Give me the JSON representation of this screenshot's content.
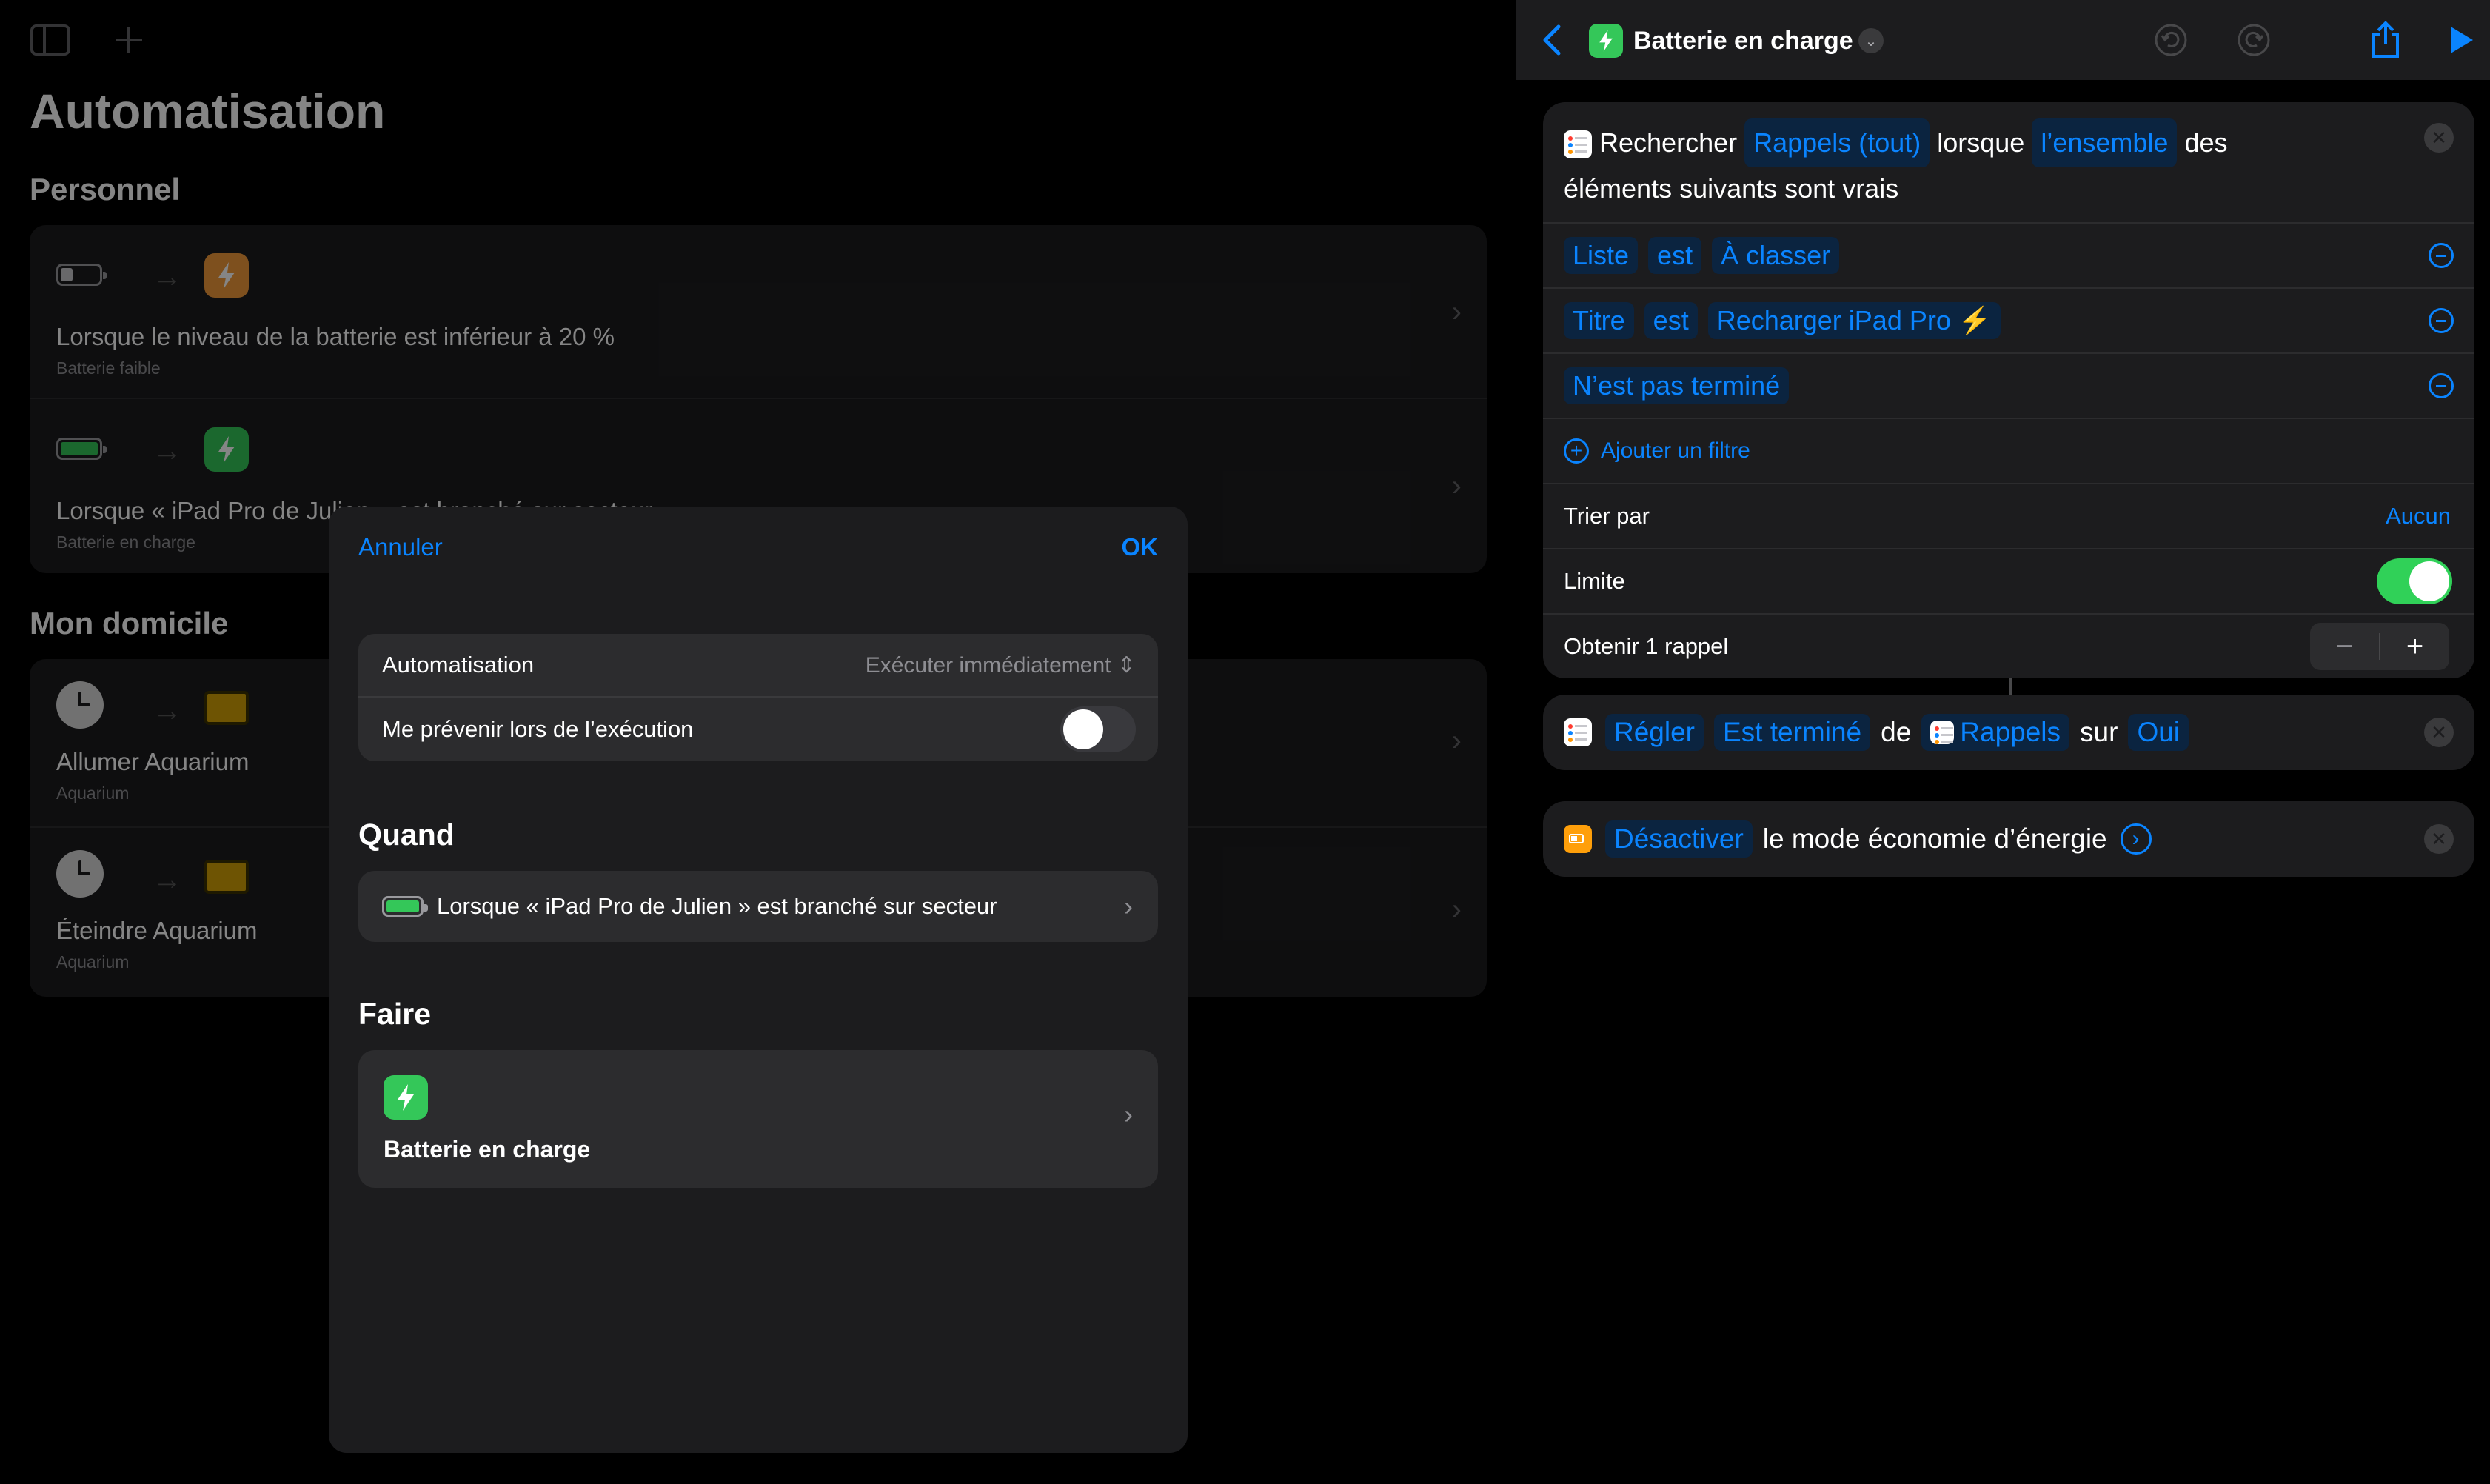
{
  "left": {
    "title": "Automatisation",
    "sections": [
      {
        "header": "Personnel",
        "rows": [
          {
            "title": "Lorsque le niveau de la batterie est inférieur à 20 %",
            "subtitle": "Batterie faible",
            "trigger_icon": "battery-low-icon",
            "action_icon": "bolt-icon",
            "action_color": "#f29a3b"
          },
          {
            "title": "Lorsque « iPad Pro de Julien » est branché sur secteur",
            "subtitle": "Batterie en charge",
            "trigger_icon": "battery-charging-icon",
            "action_icon": "bolt-icon",
            "action_color": "#34c759"
          }
        ]
      },
      {
        "header": "Mon domicile",
        "rows": [
          {
            "title": "Allumer Aquarium",
            "subtitle": "Aquarium",
            "trigger_icon": "clock-icon",
            "action_icon": "aquarium-icon"
          },
          {
            "title": "Éteindre Aquarium",
            "subtitle": "Aquarium",
            "trigger_icon": "clock-icon",
            "action_icon": "aquarium-icon"
          }
        ]
      }
    ]
  },
  "modal": {
    "cancel": "Annuler",
    "ok": "OK",
    "settings": {
      "automation_label": "Automatisation",
      "automation_value": "Exécuter immédiatement",
      "notify_label": "Me prévenir lors de l’exécution",
      "notify_on": false
    },
    "when_header": "Quand",
    "when_text": "Lorsque « iPad Pro de Julien » est branché sur secteur",
    "do_header": "Faire",
    "do_text": "Batterie en charge"
  },
  "right": {
    "shortcut_title": "Batterie en charge",
    "find": {
      "verb": "Rechercher",
      "entity": "Rappels (tout)",
      "when": "lorsque",
      "quantifier": "l’ensemble",
      "tail": "des",
      "line2": "éléments suivants sont vrais",
      "filters": [
        {
          "a": "Liste",
          "op": "est",
          "b": "À classer"
        },
        {
          "a": "Titre",
          "op": "est",
          "b": "Recharger iPad Pro ⚡️"
        },
        {
          "a": "N’est pas terminé"
        }
      ],
      "add_filter": "Ajouter un filtre",
      "sort_label": "Trier par",
      "sort_value": "Aucun",
      "limit_label": "Limite",
      "limit_on": true,
      "get_label": "Obtenir 1 rappel"
    },
    "set_action": {
      "verb": "Régler",
      "property": "Est terminé",
      "of": "de",
      "target": "Rappels",
      "to": "sur",
      "value": "Oui"
    },
    "power_action": {
      "verb": "Désactiver",
      "text": "le mode économie d’énergie"
    }
  },
  "colors": {
    "accent": "#0a84ff",
    "green": "#34c759",
    "orange": "#f29a3b",
    "card": "#1c1c1e"
  }
}
